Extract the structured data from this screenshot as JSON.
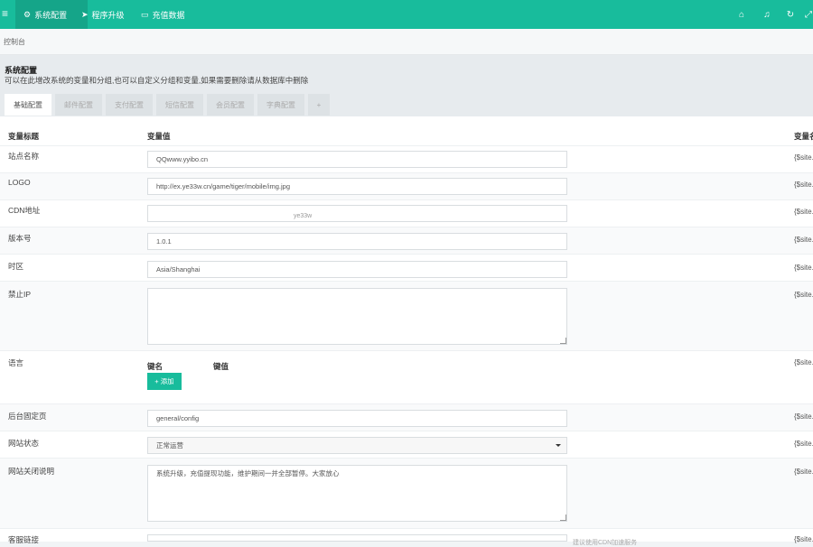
{
  "topbar": {
    "menu_icon": "≡",
    "nav": [
      {
        "label": "系统配置",
        "icon": "gear-icon",
        "glyph": "⚙"
      },
      {
        "label": "程序升级",
        "icon": "paper-plane-icon",
        "glyph": "➤"
      },
      {
        "label": "充值数据",
        "icon": "card-icon",
        "glyph": "▭"
      }
    ],
    "icons": {
      "home": "⌂",
      "bell": "♫",
      "refresh": "↻",
      "fullscreen": "⤢"
    },
    "accent": "#18bc9c"
  },
  "breadcrumb": {
    "label": "控制台"
  },
  "header": {
    "title": "系统配置",
    "desc": "可以在此增改系统的变量和分组,也可以自定义分组和变量,如果需要删除请从数据库中删除",
    "tabs": [
      "基础配置",
      "邮件配置",
      "支付配置",
      "短信配置",
      "会员配置",
      "字典配置",
      "+"
    ]
  },
  "table": {
    "headers": {
      "title": "变量标题",
      "value": "变量值",
      "name": "变量名"
    },
    "rows": [
      {
        "label": "站点名称",
        "value": "QQwww.yyibo.cn",
        "var": "{$site.name}"
      },
      {
        "label": "LOGO",
        "value": "http://ex.ye33w.cn/game/tiger/mobile/img.jpg",
        "var": "{$site.logo}"
      },
      {
        "label": "CDN地址",
        "value": "",
        "var": "{$site.cdnurl}"
      },
      {
        "label": "版本号",
        "value": "1.0.1",
        "var": "{$site.version}"
      },
      {
        "label": "时区",
        "value": "Asia/Shanghai",
        "var": "{$site.timezone}"
      },
      {
        "label": "禁止IP",
        "value": "",
        "var": "{$site.forbiddenip}"
      },
      {
        "label": "语言",
        "var": "{$site.languages}"
      },
      {
        "label": "后台固定页",
        "value": "general/config",
        "var": "{$site.fixedpage}"
      },
      {
        "label": "网站状态",
        "value": "正常运营",
        "var": "{$site.status}"
      },
      {
        "label": "网站关闭说明",
        "value": "系统升级，充值提现功能，维护期间一并全部暂停。大家放心",
        "var": "{$site.closemsg}"
      },
      {
        "label": "客服链接",
        "value": "",
        "var": "{$site.kefu}"
      }
    ],
    "lang_headers": {
      "key": "键名",
      "val": "键值"
    },
    "add_label": "添加",
    "hint": "建议使用CDN加速服务"
  },
  "watermark": "ye33w"
}
